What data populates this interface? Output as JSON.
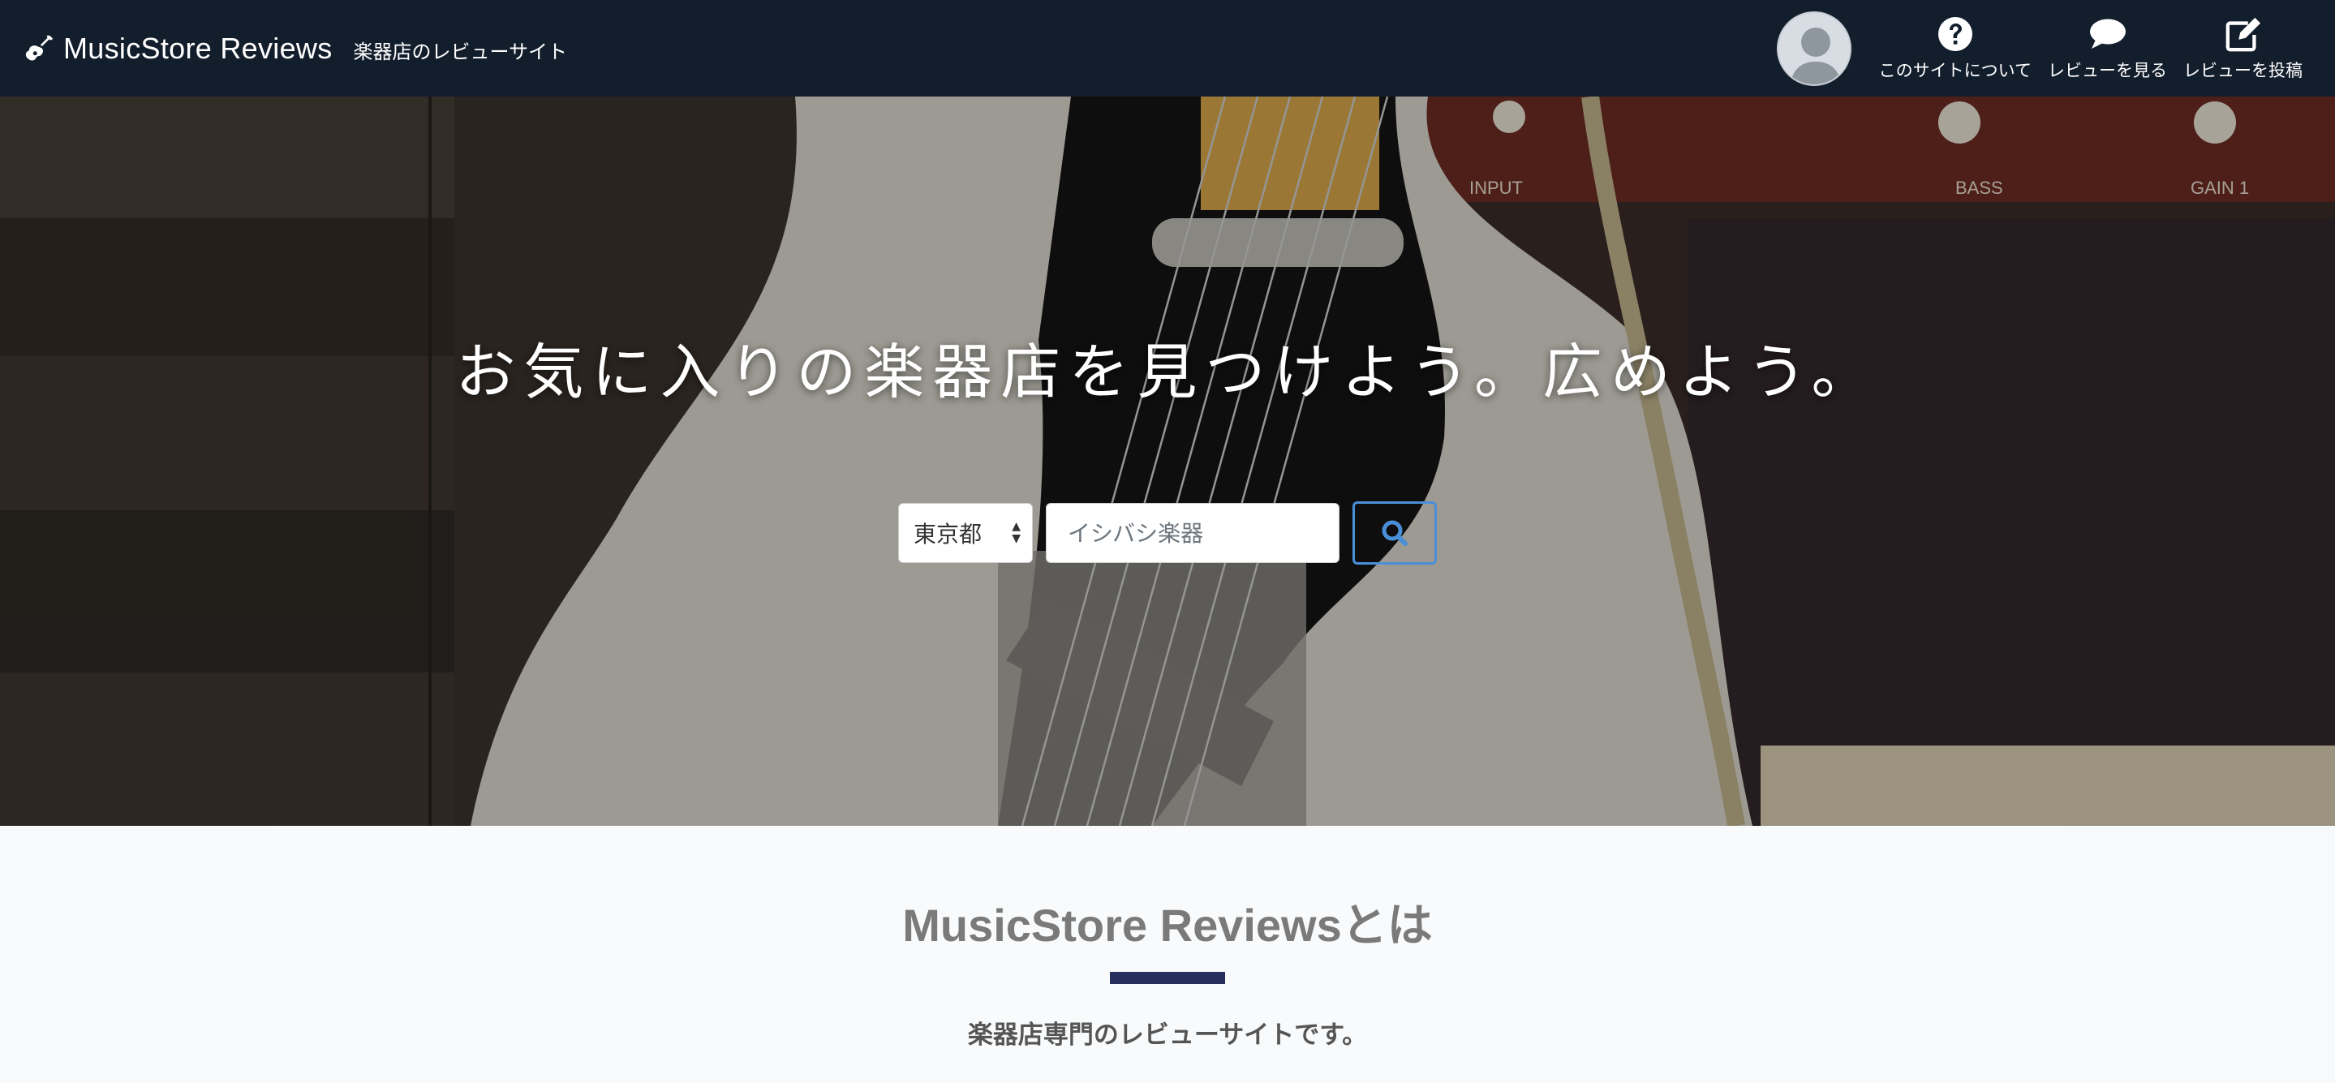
{
  "navbar": {
    "brand_title": "MusicStore Reviews",
    "brand_subtitle": "楽器店のレビューサイト",
    "items": [
      {
        "label": "このサイトについて",
        "icon": "question-circle-icon"
      },
      {
        "label": "レビューを見る",
        "icon": "comment-icon"
      },
      {
        "label": "レビューを投稿",
        "icon": "edit-icon"
      }
    ]
  },
  "hero": {
    "heading": "お気に入りの楽器店を見つけよう。広めよう。",
    "prefecture_value": "東京都",
    "search_placeholder": "イシバシ楽器",
    "search_button_icon": "search-icon"
  },
  "about": {
    "title": "MusicStore Reviewsとは",
    "subtitle": "楽器店専門のレビューサイトです。"
  },
  "colors": {
    "navbar_bg": "#131e2d",
    "accent_divider": "#272f5c",
    "search_button_border": "#4a8fd8"
  }
}
